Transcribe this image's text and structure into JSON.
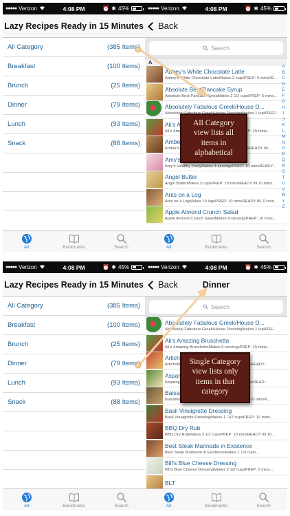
{
  "status_bar": {
    "carrier": "Verizon",
    "time": "4:08 PM",
    "battery": "45%",
    "battery_level": 0.45
  },
  "home": {
    "title": "Lazy Recipes Ready in 15 Minutes",
    "categories": [
      {
        "name": "All Category",
        "count": "(385 Items)"
      },
      {
        "name": "Breakfast",
        "count": "(100 Items)"
      },
      {
        "name": "Brunch",
        "count": "(25 Items)"
      },
      {
        "name": "Dinner",
        "count": "(79 Items)"
      },
      {
        "name": "Lunch",
        "count": "(93 Items)"
      },
      {
        "name": "Snack",
        "count": "(88 Items)"
      }
    ]
  },
  "tabs": {
    "all": "All",
    "bookmarks": "Bookmarks",
    "search": "Search"
  },
  "all_view": {
    "back": "Back",
    "search_placeholder": "Search",
    "section": "A",
    "recipes": [
      {
        "title": "Abbey's White Chocolate Latte",
        "sub": "Abbey's White Chocolate LatteMakes 2 cupsPREP: 5 minsREA..."
      },
      {
        "title": "Absolute Best Pancake Syrup",
        "sub": "Absolute Best Pancake SyrupMakes 2 1/2 cupsPREP: 5 mins..."
      },
      {
        "title": "Absolutely Fabulous Greek/House D...",
        "sub": "Absolutely Fabulous Greek/House DressingMakes 1 cupPREP..."
      },
      {
        "title": "Ali's Amazing Bruschetta",
        "sub": "Ali's Amazing BruschettaMakes 6 servingsPREP: 15 mins..."
      },
      {
        "title": "Amber's Apple Dip",
        "sub": "Amber's Apple DipMakes 3 cupsPREP: 10 minsREADY IN..."
      },
      {
        "title": "Amy's Healthy Fruity",
        "sub": "Amy's Healthy FruityMakes 4 servingsPREP: 10 minsREADY..."
      },
      {
        "title": "Angel Butter",
        "sub": "Angel ButterMakes 3 cupsPREP: 10 minsREADY IN 10 mins..."
      },
      {
        "title": "Ants on a Log",
        "sub": "Ants on a LogMakes 10 logsPREP: 10 minsREADY IN 10 mins..."
      },
      {
        "title": "Apple Almond Crunch Salad",
        "sub": "Apple Almond Crunch SaladMakes 4 servingsPREP: 10 mins..."
      }
    ],
    "index": [
      "A",
      "B",
      "C",
      "D",
      "E",
      "F",
      "G",
      "H",
      "I",
      "J",
      "K",
      "L",
      "M",
      "N",
      "O",
      "P",
      "Q",
      "R",
      "S",
      "T",
      "U",
      "V",
      "W",
      "Y",
      "Z"
    ]
  },
  "dinner_view": {
    "back": "Back",
    "title": "Dinner",
    "search_placeholder": "Search",
    "recipes": [
      {
        "title": "Absolutely Fabulous Greek/House D...",
        "sub": "Absolutely Fabulous Greek/House DressingMakes 1 cupPRE..."
      },
      {
        "title": "Ali's Amazing Bruschetta",
        "sub": "Ali's Amazing BruschettaMakes 6 servingsPREP: 15 mins..."
      },
      {
        "title": "Artichoke Salad",
        "sub": "Artichoke SaladMakes 4 servingsPREP: 10 minsREADY..."
      },
      {
        "title": "Asparagus Salad",
        "sub": "Asparagus SaladMakes 4 servingsPREP: 10 minsREAD..."
      },
      {
        "title": "Balsamic Glazed Salad",
        "sub": "Balsamic Glazed SaladMakes 4 servingsPREP: 10 minsR..."
      },
      {
        "title": "Basil Vinaigrette Dressing",
        "sub": "Basil Vinaigrette DressingMakes 1 -1/2 cupsPREP: 10 mins..."
      },
      {
        "title": "BBQ Dry Rub",
        "sub": "BBQ Dry RubMakes 3 1/2 cupsPREP: 10 minsREADY IN 10..."
      },
      {
        "title": "Best Steak Marinade in Existence",
        "sub": "Best Steak Marinade in ExistenceMakes 1 1/3 cups..."
      },
      {
        "title": "Bill's Blue Cheese Dressing",
        "sub": "Bill's Blue Cheese DressingMakes 2 1/2 cupsPREP: 5 mins..."
      },
      {
        "title": "BLT",
        "sub": ""
      }
    ]
  },
  "callouts": {
    "all": "All Category view lists all items in alphabetical",
    "single": "Single Category view lists only items in that category"
  }
}
